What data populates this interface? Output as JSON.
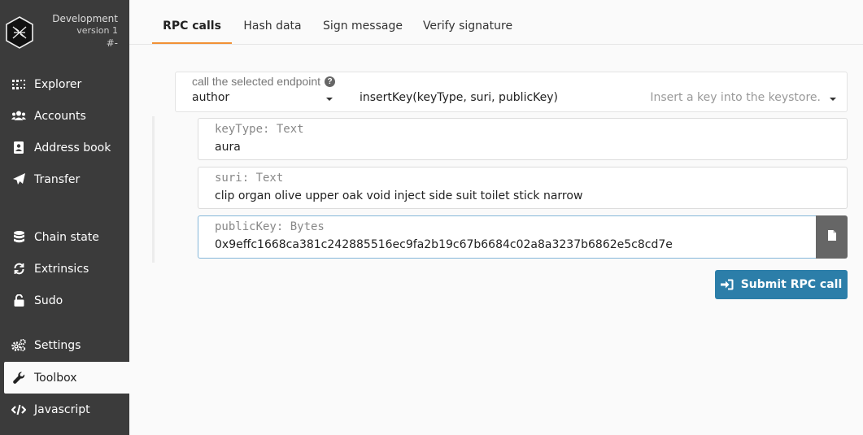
{
  "chain": {
    "name": "Development",
    "version": "version 1",
    "block": "#-"
  },
  "sidebar": {
    "items": [
      {
        "label": "Explorer",
        "icon": "explorer-icon"
      },
      {
        "label": "Accounts",
        "icon": "users-icon"
      },
      {
        "label": "Address book",
        "icon": "address-book-icon"
      },
      {
        "label": "Transfer",
        "icon": "paper-plane-icon"
      },
      {
        "label": "Chain state",
        "icon": "database-icon"
      },
      {
        "label": "Extrinsics",
        "icon": "sync-icon"
      },
      {
        "label": "Sudo",
        "icon": "unlock-icon"
      },
      {
        "label": "Settings",
        "icon": "cogs-icon"
      },
      {
        "label": "Toolbox",
        "icon": "wrench-icon"
      },
      {
        "label": "Javascript",
        "icon": "code-icon"
      }
    ]
  },
  "tabs": [
    {
      "label": "RPC calls",
      "active": true
    },
    {
      "label": "Hash data"
    },
    {
      "label": "Sign message"
    },
    {
      "label": "Verify signature"
    }
  ],
  "endpoint": {
    "label": "call the selected endpoint",
    "section": "author",
    "method": "insertKey(keyType, suri, publicKey)",
    "description": "Insert a key into the keystore."
  },
  "params": [
    {
      "label": "keyType: Text",
      "value": "aura"
    },
    {
      "label": "suri: Text",
      "value": "clip organ olive upper oak void inject side suit toilet stick narrow"
    },
    {
      "label": "publicKey: Bytes",
      "value": "0x9effc1668ca381c242885516ec9fa2b19c67b6684c02a8a3237b6862e5c8cd7e"
    }
  ],
  "submit": {
    "label": "Submit RPC call"
  },
  "colors": {
    "sidebar": "#3b3b3b",
    "accent": "#f19135",
    "button": "#2c7ea9"
  }
}
